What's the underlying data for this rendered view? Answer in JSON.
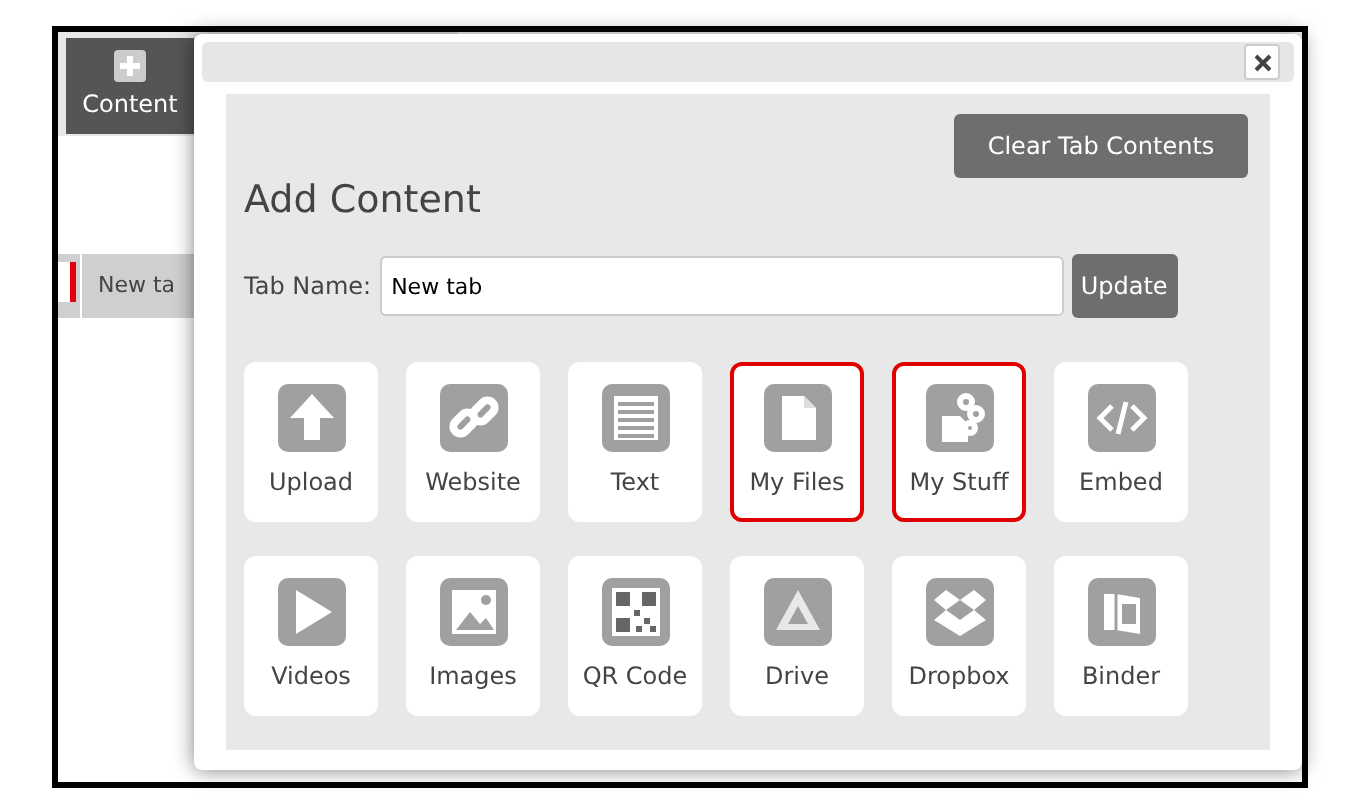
{
  "toolbar": {
    "content_button": "Content"
  },
  "background_tabs": [
    {
      "label": "New ta"
    }
  ],
  "dialog": {
    "clear_button": "Clear Tab Contents",
    "title": "Add Content",
    "tab_name": {
      "label": "Tab Name:",
      "value": "New tab"
    },
    "update_button": "Update",
    "tiles": [
      {
        "label": "Upload",
        "highlighted": false
      },
      {
        "label": "Website",
        "highlighted": false
      },
      {
        "label": "Text",
        "highlighted": false
      },
      {
        "label": "My Files",
        "highlighted": true
      },
      {
        "label": "My Stuff",
        "highlighted": true
      },
      {
        "label": "Embed",
        "highlighted": false
      },
      {
        "label": "Videos",
        "highlighted": false
      },
      {
        "label": "Images",
        "highlighted": false
      },
      {
        "label": "QR Code",
        "highlighted": false
      },
      {
        "label": "Drive",
        "highlighted": false
      },
      {
        "label": "Dropbox",
        "highlighted": false
      },
      {
        "label": "Binder",
        "highlighted": false
      }
    ]
  }
}
